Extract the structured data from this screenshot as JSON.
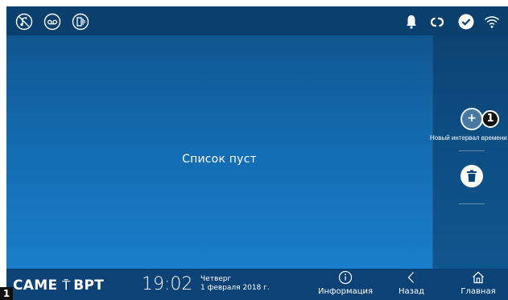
{
  "status_bar": {
    "left_icons": [
      "music-off-icon",
      "voicemail-icon",
      "door-intercom-icon"
    ],
    "right_icons": [
      "bell-icon",
      "link-icon",
      "check-circle-icon",
      "wifi-icon"
    ]
  },
  "main": {
    "empty_message": "Список пуст"
  },
  "side_panel": {
    "add_button_label": "Новый интервал времени",
    "add_button_icon": "plus-icon",
    "callout_number": "1",
    "delete_button_icon": "trash-icon"
  },
  "bottom_bar": {
    "brand_left": "CAME",
    "brand_right": "BPT",
    "time": "19:02",
    "weekday": "Четверг",
    "date": "1 февраля 2018 г.",
    "nav": [
      {
        "label": "Информация",
        "icon": "info-icon"
      },
      {
        "label": "Назад",
        "icon": "back-chevron-icon"
      },
      {
        "label": "Главная",
        "icon": "home-icon"
      }
    ]
  },
  "figure_number": "1",
  "colors": {
    "background_top": "#0f4f86",
    "background_bottom": "#1a83cf",
    "bar": "#0c4275"
  }
}
